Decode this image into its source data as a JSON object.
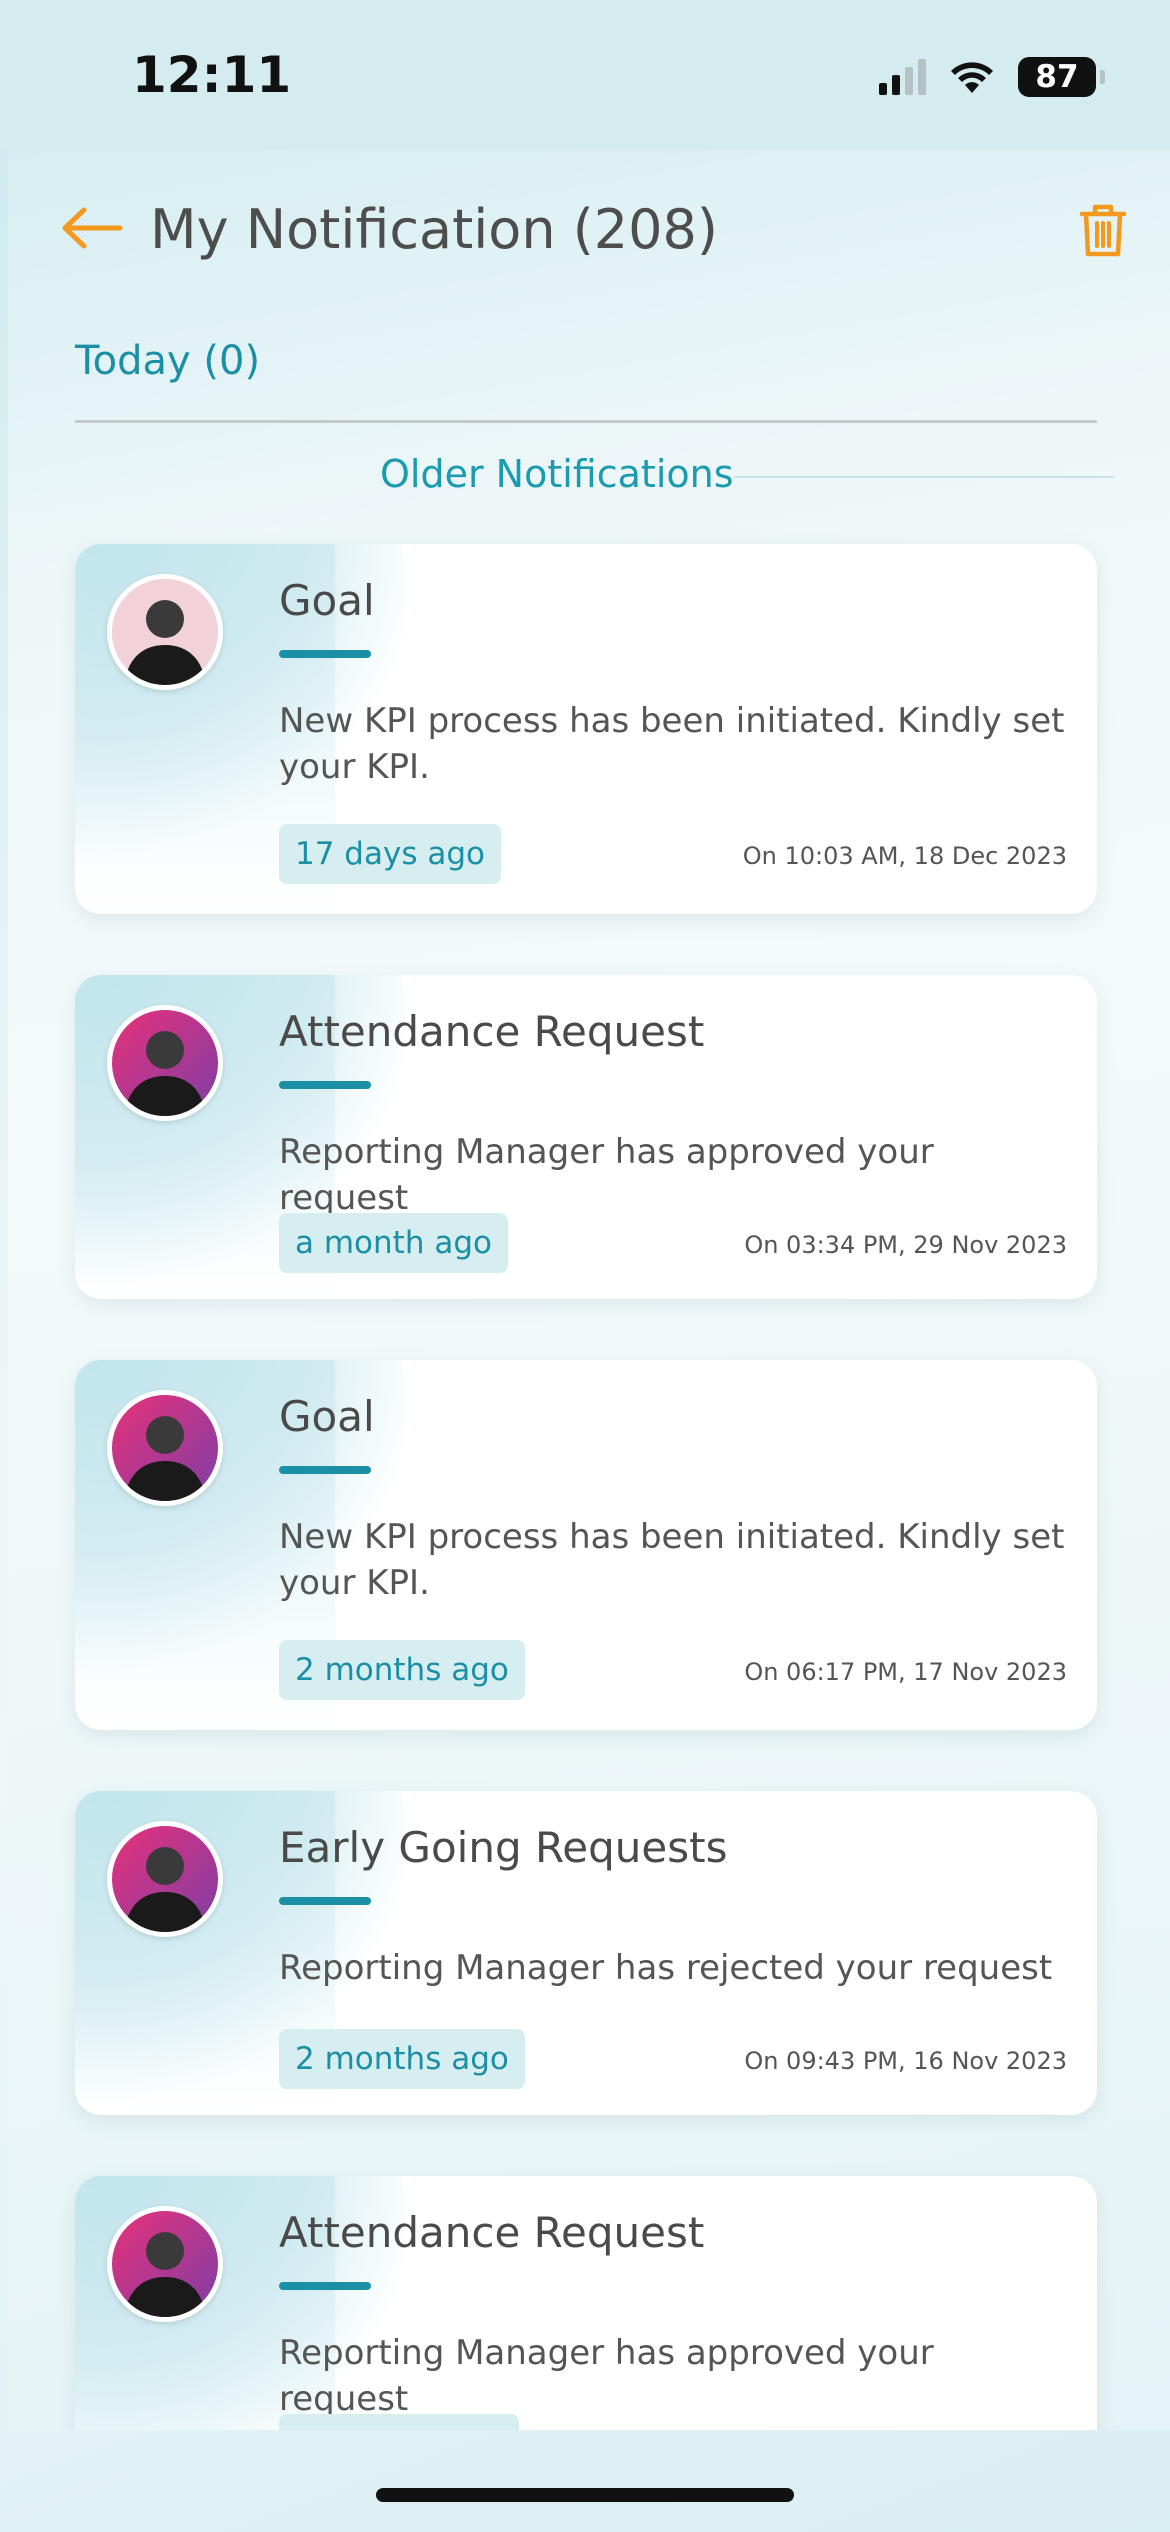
{
  "status_bar": {
    "time": "12:11",
    "battery": "87"
  },
  "header": {
    "title": "My Notification (208)"
  },
  "sections": {
    "today": "Today (0)",
    "older": "Older Notifications"
  },
  "notifications": [
    {
      "title": "Goal",
      "message": "New KPI process has been initiated. Kindly set your KPI.",
      "relative_time": "17 days ago",
      "timestamp": "On 10:03 AM, 18 Dec 2023"
    },
    {
      "title": "Attendance Request",
      "message": "Reporting Manager  has approved your request",
      "relative_time": "a month ago",
      "timestamp": "On 03:34 PM, 29 Nov 2023"
    },
    {
      "title": "Goal",
      "message": "New KPI process has been initiated. Kindly set your KPI.",
      "relative_time": "2 months ago",
      "timestamp": "On 06:17 PM, 17 Nov 2023"
    },
    {
      "title": "Early Going Requests",
      "message": "Reporting Manager  has rejected your request",
      "relative_time": "2 months ago",
      "timestamp": "On 09:43 PM, 16 Nov 2023"
    },
    {
      "title": "Attendance Request",
      "message": "Reporting Manager  has approved your request"
    }
  ],
  "colors": {
    "accent": "#1b8fa5",
    "icon_orange": "#f39a1e",
    "badge_bg": "#d7eef1"
  }
}
